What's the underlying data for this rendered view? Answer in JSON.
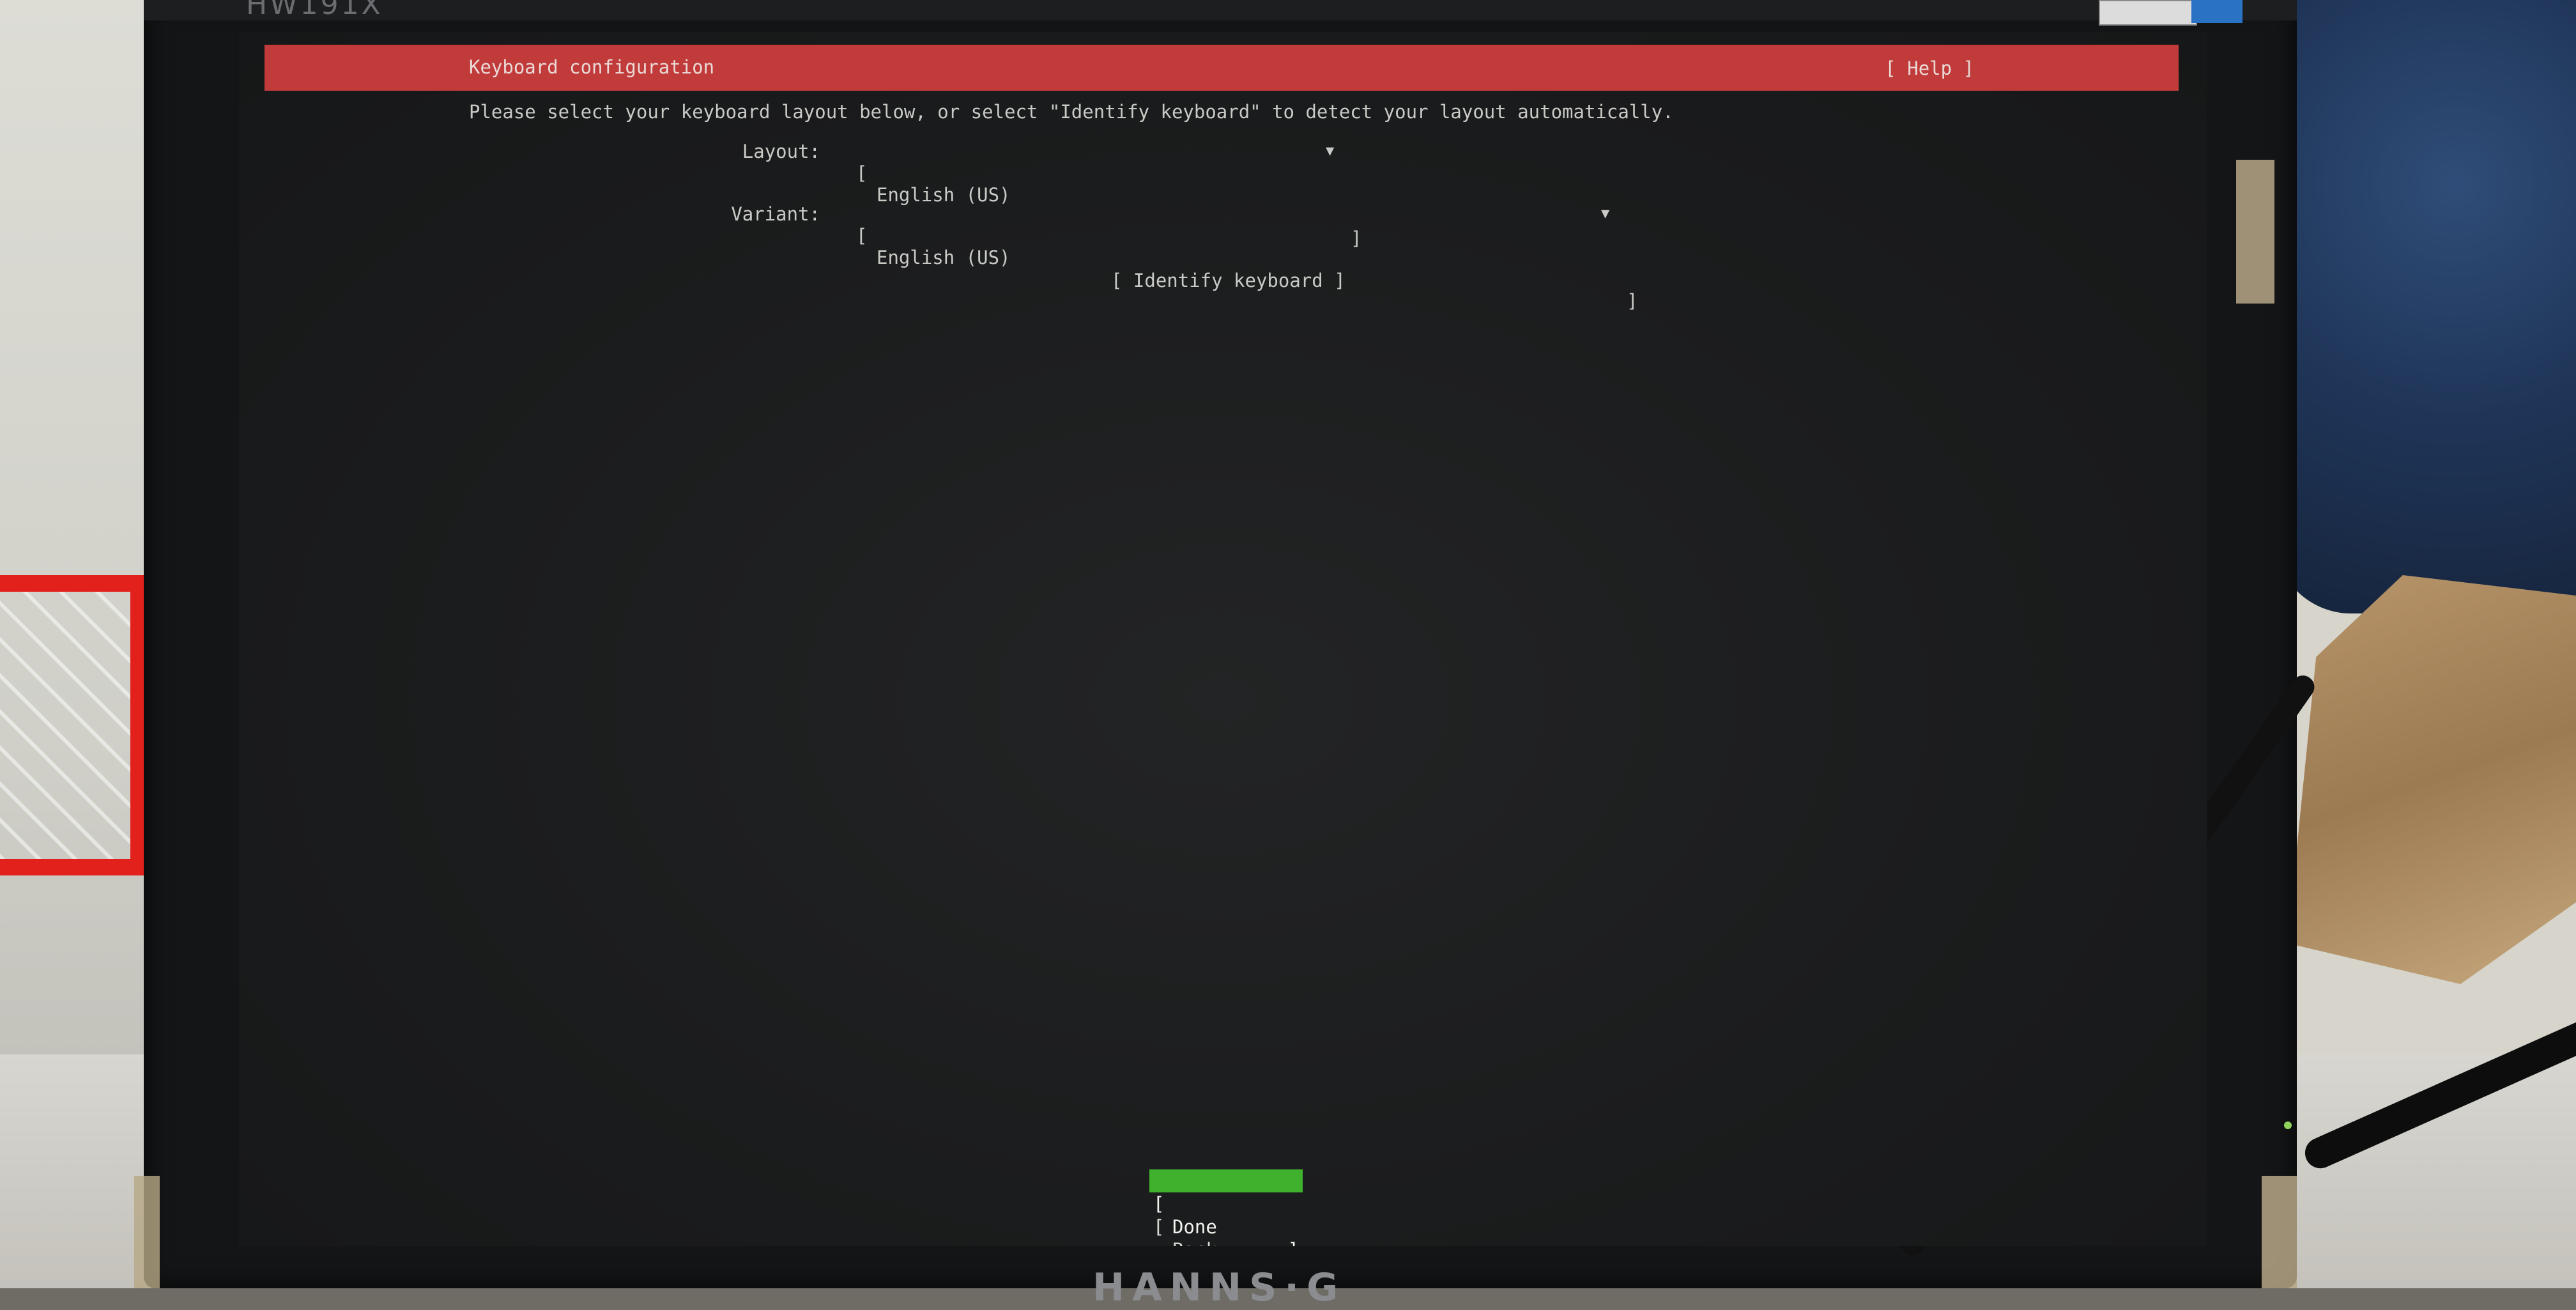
{
  "monitor": {
    "model_label": "HW191X",
    "brand": "HANNS·G"
  },
  "screen": {
    "title": "Keyboard configuration",
    "help_label": "[ Help ]",
    "instructions": "Please select your keyboard layout below, or select \"Identify keyboard\" to detect your layout automatically.",
    "layout": {
      "label": "Layout:",
      "value": "English (US)",
      "open": "[",
      "close": "]",
      "arrow": "▼"
    },
    "variant": {
      "label": "Variant:",
      "value": "English (US)",
      "open": "[",
      "close": "]",
      "arrow": "▼"
    },
    "identify_label": "[ Identify keyboard ]",
    "buttons": {
      "done": {
        "open": "[",
        "label": "Done",
        "close": "]"
      },
      "back": {
        "open": "[",
        "label": "Back",
        "close": "]"
      }
    }
  },
  "colors": {
    "titlebar": "#c13b3b",
    "focused_button": "#3fb12d",
    "screen_bg": "#1b1c1d",
    "text": "#c9c9c6"
  }
}
